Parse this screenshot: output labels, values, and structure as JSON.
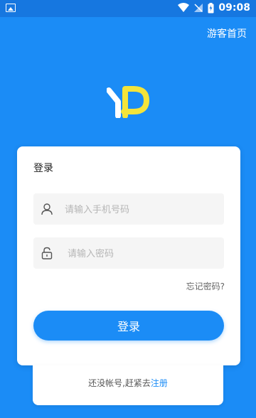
{
  "status_bar": {
    "time": "09:08"
  },
  "header": {
    "guest_link": "游客首页"
  },
  "login": {
    "title": "登录",
    "phone_placeholder": "请输入手机号码",
    "password_placeholder": "请输入密码",
    "forgot": "忘记密码?",
    "submit": "登录"
  },
  "register": {
    "prompt": "还没帐号,赶紧去",
    "link": "注册"
  },
  "colors": {
    "primary": "#1b8cf6",
    "logo_yellow": "#f4e43a"
  }
}
